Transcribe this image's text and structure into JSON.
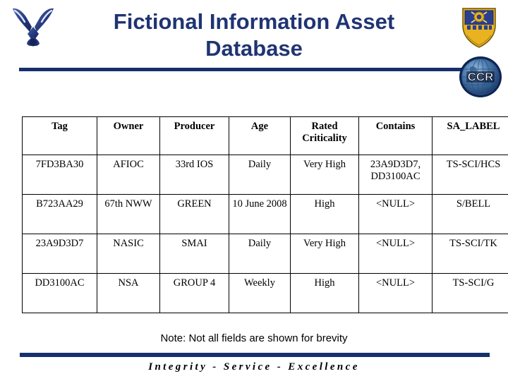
{
  "header": {
    "title": "Fictional Information Asset Database",
    "title_line1": "Fictional Information Asset",
    "title_line2": "Database",
    "rule_color": "#15306B",
    "title_color": "#1F3473",
    "logos": [
      {
        "name": "usaf-wings-logo",
        "alt": "U.S. Air Force wings symbol"
      },
      {
        "name": "unit-shield-logo",
        "alt": "Air Force unit heraldic shield"
      },
      {
        "name": "ccr-globe-logo",
        "alt": "CCR globe emblem",
        "text": "CCR"
      }
    ]
  },
  "table": {
    "columns": [
      "Tag",
      "Owner",
      "Producer",
      "Age",
      "Rated Criticality",
      "Contains",
      "SA_LABEL"
    ],
    "rows": [
      {
        "tag": "7FD3BA30",
        "owner": "AFIOC",
        "producer": "33rd IOS",
        "age": "Daily",
        "rated_criticality": "Very High",
        "contains": "23A9D3D7, DD3100AC",
        "sa_label": "TS-SCI/HCS"
      },
      {
        "tag": "B723AA29",
        "owner": "67th NWW",
        "producer": "GREEN",
        "age": "10 June 2008",
        "rated_criticality": "High",
        "contains": "<NULL>",
        "sa_label": "S/BELL"
      },
      {
        "tag": "23A9D3D7",
        "owner": "NASIC",
        "producer": "SMAI",
        "age": "Daily",
        "rated_criticality": "Very High",
        "contains": "<NULL>",
        "sa_label": "TS-SCI/TK"
      },
      {
        "tag": "DD3100AC",
        "owner": "NSA",
        "producer": "GROUP 4",
        "age": "Weekly",
        "rated_criticality": "High",
        "contains": "<NULL>",
        "sa_label": "TS-SCI/G"
      }
    ]
  },
  "footer": {
    "note": "Note: Not all fields are shown for brevity",
    "tagline": "Integrity - Service - Excellence",
    "rule_color": "#15306B"
  }
}
